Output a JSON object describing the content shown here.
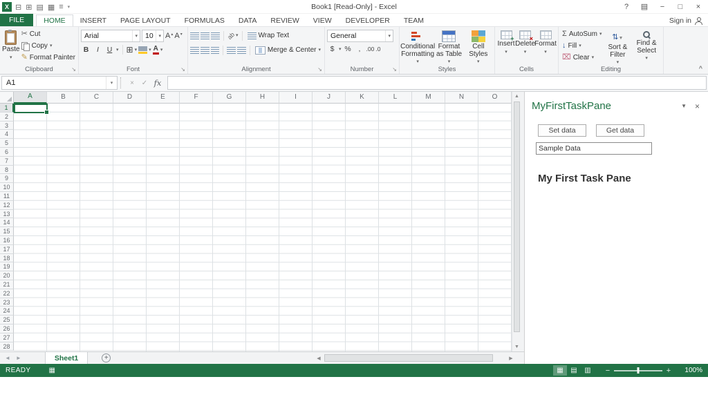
{
  "colors": {
    "accent": "#217346",
    "status_bar": "#217346",
    "selection": "#217346",
    "font_color_red": "#c00000",
    "fill_yellow": "#ffc927"
  },
  "icons": {
    "dropdown": "▾",
    "up": "▴",
    "launcher": "↘",
    "collapse_ribbon": "^",
    "scissors": "✂",
    "pencil": "✎",
    "borders": "⊞",
    "sigma": "Σ",
    "fill_arrow": "↓",
    "clear": "⌧",
    "sort": "⇅",
    "funnel": "▼",
    "up_arrow": "▲",
    "down_arrow": "▼",
    "left_arrow": "◀",
    "right_arrow": "▶"
  },
  "title_bar": {
    "logo": "X",
    "title": "Book1  [Read-Only] - Excel",
    "help": "?",
    "ribbon_options": "▤",
    "minimize": "−",
    "maximize": "□",
    "close": "×"
  },
  "qat": {
    "icons": [
      "⊟",
      "⊞",
      "▤",
      "▦",
      "≡"
    ],
    "more": "▾"
  },
  "tabs": {
    "file": "FILE",
    "items": [
      "HOME",
      "INSERT",
      "PAGE LAYOUT",
      "FORMULAS",
      "DATA",
      "REVIEW",
      "VIEW",
      "DEVELOPER",
      "TEAM"
    ],
    "active": "HOME",
    "sign_in": "Sign in"
  },
  "ribbon": {
    "clipboard": {
      "group": "Clipboard",
      "paste": "Paste",
      "cut": "Cut",
      "copy": "Copy",
      "format_painter": "Format Painter"
    },
    "font": {
      "group": "Font",
      "family": "Arial",
      "size": "10",
      "bold": "B",
      "italic": "I",
      "underline": "U",
      "grow": "A",
      "shrink": "A",
      "fontcolor": "A"
    },
    "alignment": {
      "group": "Alignment",
      "wrap": "Wrap Text",
      "merge": "Merge & Center",
      "orientation": "ab"
    },
    "number": {
      "group": "Number",
      "format": "General",
      "currency": "$",
      "percent": "%",
      "comma": ",",
      "inc_decimal": ".00",
      "dec_decimal": ".0"
    },
    "styles": {
      "group": "Styles",
      "conditional": "Conditional Formatting",
      "format_table": "Format as Table",
      "cell_styles": "Cell Styles"
    },
    "cells": {
      "group": "Cells",
      "insert": "Insert",
      "delete": "Delete",
      "format": "Format",
      "insert_ov": "+",
      "delete_ov": "×"
    },
    "editing": {
      "group": "Editing",
      "autosum": "AutoSum",
      "fill": "Fill",
      "clear": "Clear",
      "sort": "Sort & Filter",
      "find": "Find & Select"
    }
  },
  "formula_bar": {
    "name_box": "A1",
    "cancel": "×",
    "enter": "✓",
    "fx": "fx",
    "value": ""
  },
  "grid": {
    "columns": [
      "A",
      "B",
      "C",
      "D",
      "E",
      "F",
      "G",
      "H",
      "I",
      "J",
      "K",
      "L",
      "M",
      "N",
      "O"
    ],
    "row_count": 28,
    "selected_cell": "A1"
  },
  "sheet_tabs": {
    "nav_left": "◄",
    "nav_right": "►",
    "active": "Sheet1",
    "add": "+"
  },
  "task_pane": {
    "title": "MyFirstTaskPane",
    "collapse": "▼",
    "close": "×",
    "set_btn": "Set data",
    "get_btn": "Get data",
    "input_value": "Sample Data",
    "heading": "My First Task Pane"
  },
  "status_bar": {
    "mode": "READY",
    "macro": "▦",
    "views": [
      "▦",
      "▤",
      "▥"
    ],
    "zoom_out": "−",
    "zoom_in": "+",
    "zoom": "100%"
  }
}
